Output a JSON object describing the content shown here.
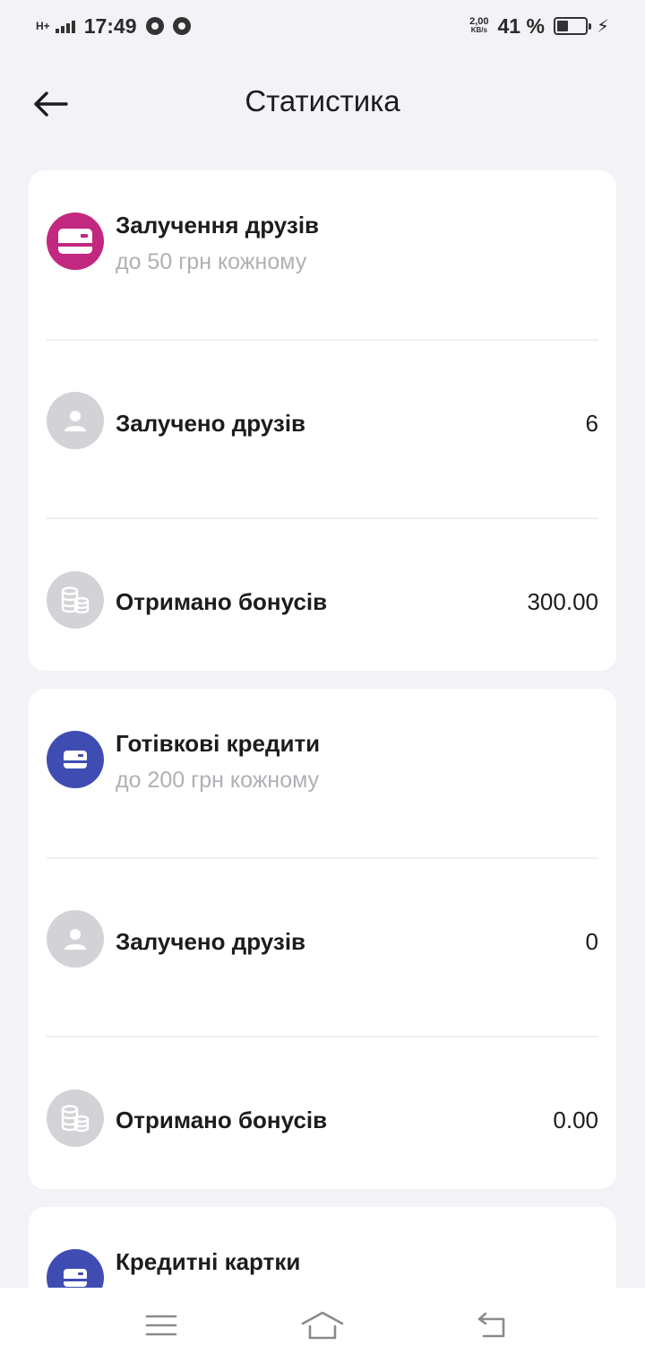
{
  "status_bar": {
    "network": "H+",
    "time": "17:49",
    "speed_value": "2,00",
    "speed_unit": "KB/s",
    "battery_percent": "41 %",
    "battery_level": 0.41
  },
  "header": {
    "title": "Статистика"
  },
  "cards": [
    {
      "title": "Залучення друзів",
      "subtitle": "до 50 грн кожному",
      "icon": "card-icon",
      "icon_color": "#c2287f",
      "rows": [
        {
          "label": "Залучено друзів",
          "value": "6",
          "icon": "person-icon"
        },
        {
          "label": "Отримано бонусів",
          "value": "300.00",
          "icon": "coins-icon"
        }
      ]
    },
    {
      "title": "Готівкові кредити",
      "subtitle": "до 200 грн кожному",
      "icon": "card-icon",
      "icon_color": "#3f4db3",
      "rows": [
        {
          "label": "Залучено друзів",
          "value": "0",
          "icon": "person-icon"
        },
        {
          "label": "Отримано бонусів",
          "value": "0.00",
          "icon": "coins-icon"
        }
      ]
    },
    {
      "title": "Кредитні картки",
      "icon": "card-icon",
      "icon_color": "#3f4db3"
    }
  ],
  "colors": {
    "background": "#f2f2f7",
    "card": "#ffffff",
    "grey_icon": "#d3d3d7",
    "subtitle": "#b0b0b5"
  },
  "nav_bar": {
    "menu_icon": "menu-icon",
    "home_icon": "home-icon",
    "back_icon": "back-icon"
  }
}
